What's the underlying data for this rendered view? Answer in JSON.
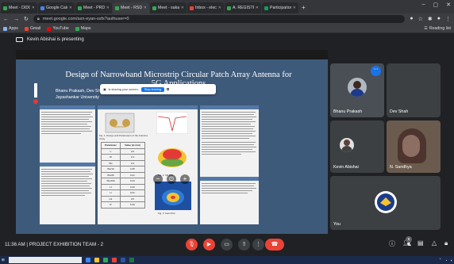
{
  "browser": {
    "tabs": [
      {
        "label": "Meet - DIDC",
        "color": "#34a853"
      },
      {
        "label": "Google Calendar",
        "color": "#4285f4"
      },
      {
        "label": "Meet - PRDB",
        "color": "#34a853"
      },
      {
        "label": "Meet - RSDB",
        "color": "#34a853"
      },
      {
        "label": "Meet - saka",
        "color": "#34a853"
      },
      {
        "label": "Inbox - electron",
        "color": "#ea4335"
      },
      {
        "label": "A. REGISTRATION",
        "color": "#34a853"
      },
      {
        "label": "Participation list",
        "color": "#0f9d58"
      }
    ],
    "new_tab": "+",
    "url": "meet.google.com/axn-eyan-ssfs?authuser=0",
    "bookmarks": [
      {
        "label": "Apps",
        "color": "#8ab4f8"
      },
      {
        "label": "Gmail",
        "color": "#ea4335"
      },
      {
        "label": "YouTube",
        "color": "#ff0000"
      },
      {
        "label": "Maps",
        "color": "#34a853"
      }
    ],
    "reading_list": "Reading list"
  },
  "meet": {
    "presenting_text": "Kevin Abishai is presenting",
    "time": "11:36 AM",
    "separator": "|",
    "meeting_name": "PROJECT EXHIBITION TEAM - 2",
    "participant_count": "6",
    "participants": [
      {
        "name": "Bhanu Prakash"
      },
      {
        "name": "Dev Shah"
      },
      {
        "name": "Kevin Abishai"
      },
      {
        "name": "N. Sandhya"
      },
      {
        "name": "You"
      }
    ]
  },
  "slide": {
    "title": "Design of Narrowband Microstrip Circular Patch Array Antenna for 5G Applications",
    "authors": "Bhanu Prakash, Dev Shah, Kevin A",
    "institution": "Jayashankar University",
    "popup_text": "is sharing your screen.",
    "popup_button": "Stop sharing",
    "fig_caption_1": "Fig. 1. Design and Parameters of the Antenna Array",
    "fig_caption_2": "Fig. 2. 3D Plot",
    "fig_caption_3": "Fig. 3. Gain Plot",
    "table": {
      "headers": [
        "Parameter",
        "Value (in mm)"
      ],
      "rows": [
        [
          "L",
          "3.5"
        ],
        [
          "W",
          "3.3"
        ],
        [
          "Ws",
          "0.3"
        ],
        [
          "Ws/10",
          "0.35"
        ],
        [
          "Ws/25",
          "0.21"
        ],
        [
          "Ws/100",
          "0.44"
        ],
        [
          "Lf",
          "0.26"
        ],
        [
          "H",
          "0.61"
        ],
        [
          "H1",
          "0.5"
        ],
        [
          "R",
          "5.29"
        ]
      ]
    }
  }
}
